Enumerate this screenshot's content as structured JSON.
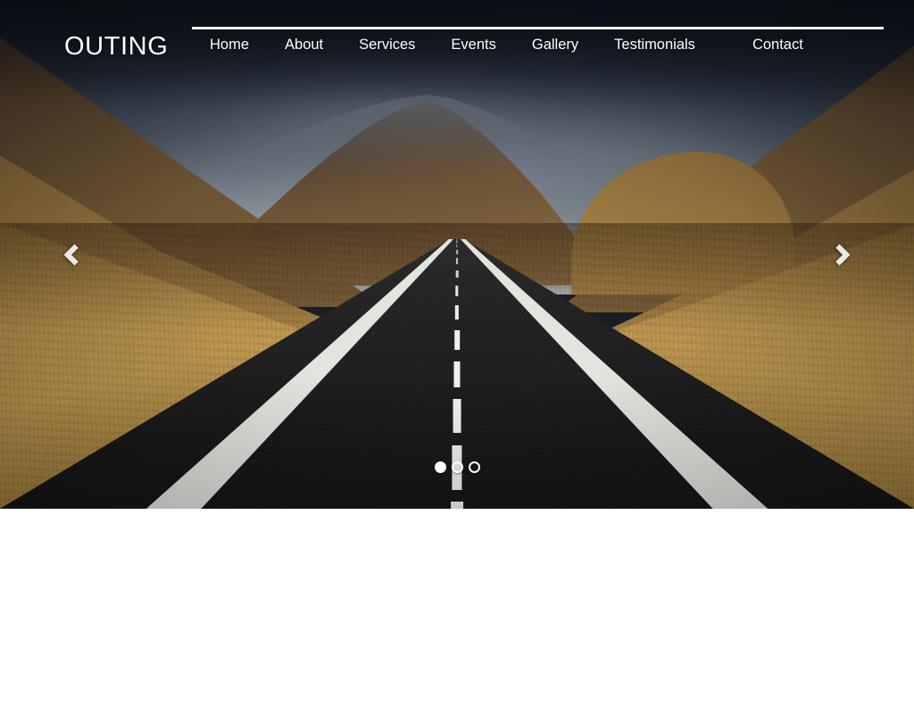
{
  "site": {
    "brand": "OUTING"
  },
  "nav": {
    "items": [
      {
        "label": "Home",
        "name": "nav-item-home"
      },
      {
        "label": "About",
        "name": "nav-item-about"
      },
      {
        "label": "Services",
        "name": "nav-item-services"
      },
      {
        "label": "Events",
        "name": "nav-item-events"
      },
      {
        "label": "Gallery",
        "name": "nav-item-gallery"
      },
      {
        "label": "Testimonials",
        "name": "nav-item-testimonials"
      },
      {
        "label": "Contact",
        "name": "nav-item-contact"
      }
    ]
  },
  "hero": {
    "type": "image-carousel",
    "scene": "mountain valley road at dusk",
    "prev_icon": "chevron-left-icon",
    "next_icon": "chevron-right-icon",
    "slide_count": 3,
    "active_slide": 1,
    "indicators": [
      {
        "label": "1",
        "active": true
      },
      {
        "label": "2",
        "active": false
      },
      {
        "label": "3",
        "active": false
      }
    ]
  },
  "colors": {
    "nav_text": "#ffffff",
    "nav_rule": "#f2f2f2",
    "sky_top": "#141821",
    "sky_bottom": "#b3b8bc",
    "hill_gold": "#b08c4a",
    "road_dark": "#1d1d1e",
    "page_background": "#ffffff"
  }
}
